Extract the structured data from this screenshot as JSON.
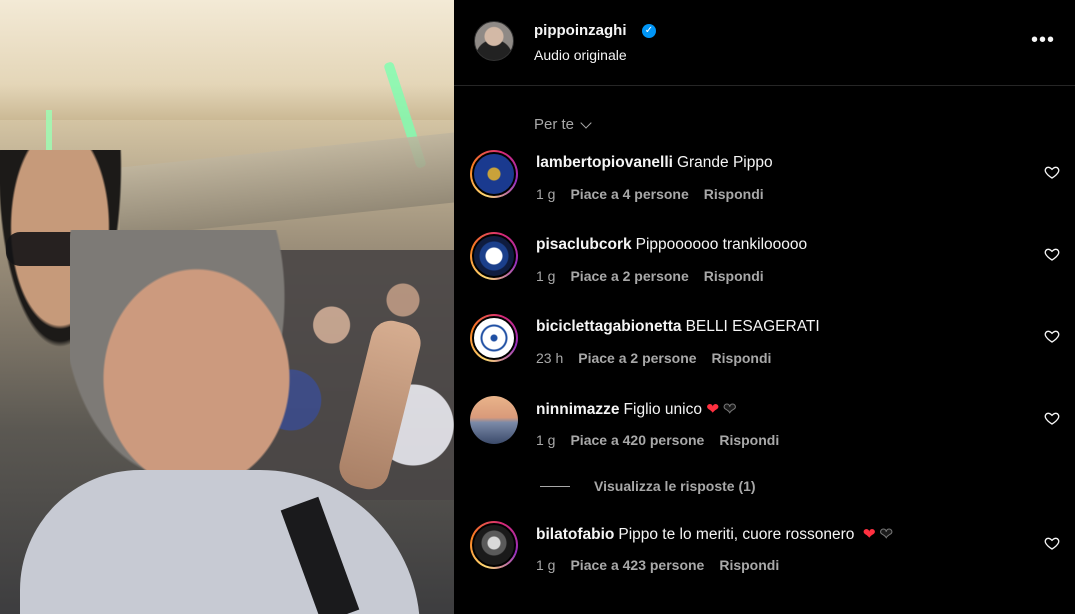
{
  "post": {
    "username": "pippoinzaghi",
    "verified": true,
    "audio": "Audio originale",
    "more_icon": "more-horizontal-icon"
  },
  "sort": {
    "label": "Per te"
  },
  "comments": [
    {
      "username": "lambertopiovanelli",
      "text": "Grande Pippo",
      "time": "1 g",
      "likes": "Piace a 4 persone",
      "reply": "Rispondi",
      "avatar_colors": [
        "#1a3a8f",
        "#c9a23a"
      ]
    },
    {
      "username": "pisaclubcork",
      "text": "Pippoooooo trankilooooo",
      "time": "1 g",
      "likes": "Piace a 2 persone",
      "reply": "Rispondi",
      "avatar_colors": [
        "#1b3f8b",
        "#0f1c3f"
      ]
    },
    {
      "username": "biciclettagabionetta",
      "text": "BELLI ESAGERATI",
      "time": "23 h",
      "likes": "Piace a 2 persone",
      "reply": "Rispondi",
      "avatar_colors": [
        "#ffffff",
        "#1f4fa3"
      ]
    },
    {
      "username": "ninnimazze",
      "text": "Figlio unico",
      "time": "1 g",
      "likes": "Piace a 420 persone",
      "reply": "Rispondi",
      "avatar_colors": [
        "#e9b48a",
        "#3b4a6a"
      ]
    },
    {
      "username": "bilatofabio",
      "text": "Pippo te lo meriti, cuore rossonero",
      "time": "1 g",
      "likes": "Piace a 423 persone",
      "reply": "Rispondi",
      "avatar_colors": [
        "#d9d9d9",
        "#1a1a1a"
      ]
    }
  ],
  "view_replies": "Visualizza le risposte (1)"
}
